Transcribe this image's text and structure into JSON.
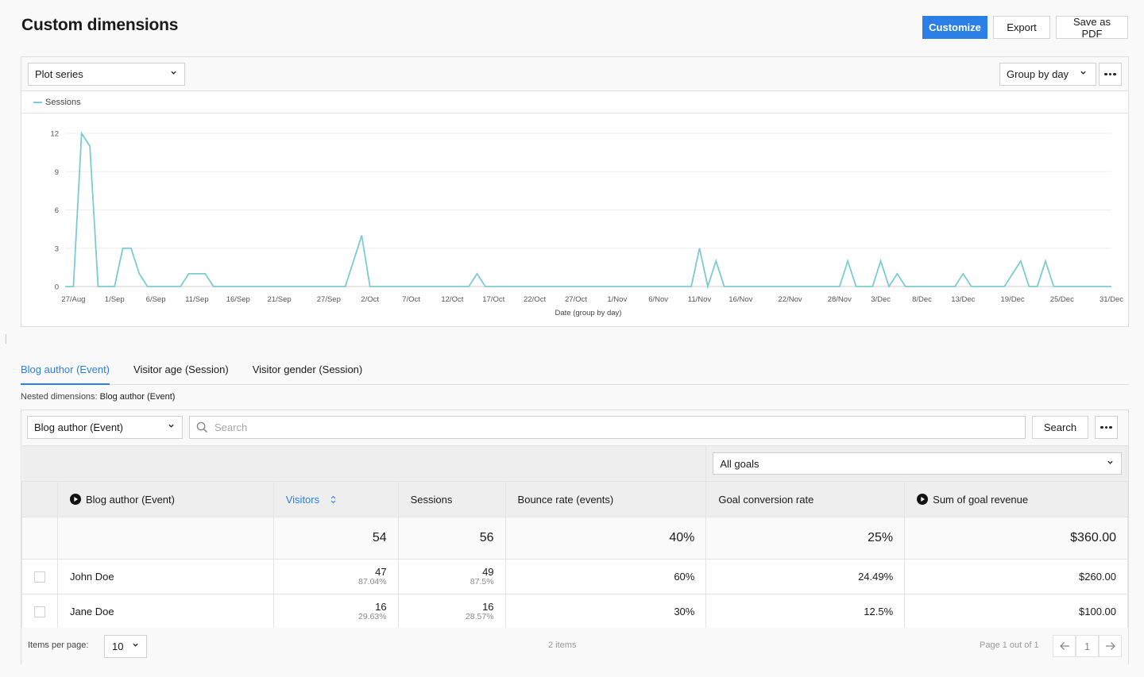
{
  "header": {
    "title": "Custom dimensions",
    "actions": {
      "customize": "Customize",
      "export": "Export",
      "save_pdf": "Save as PDF"
    }
  },
  "colors": {
    "accent": "#2b7fe6",
    "series": "#7ccbd3"
  },
  "chart_toolbar": {
    "plot_series": "Plot series",
    "group_by": "Group by day",
    "more": "more-options"
  },
  "chart_data": {
    "type": "line",
    "title": "",
    "legend": [
      "Sessions"
    ],
    "legend_position": "top-left",
    "xlabel": "Date (group by day)",
    "ylabel": "",
    "ylim": [
      0,
      12
    ],
    "yticks": [
      0,
      3,
      6,
      9,
      12
    ],
    "grid": true,
    "start_date": "26/Aug",
    "end_date": "31/Dec",
    "xtick_labels": [
      {
        "label": "27/Aug",
        "index": 1
      },
      {
        "label": "1/Sep",
        "index": 6
      },
      {
        "label": "6/Sep",
        "index": 11
      },
      {
        "label": "11/Sep",
        "index": 16
      },
      {
        "label": "16/Sep",
        "index": 21
      },
      {
        "label": "21/Sep",
        "index": 26
      },
      {
        "label": "27/Sep",
        "index": 32
      },
      {
        "label": "2/Oct",
        "index": 37
      },
      {
        "label": "7/Oct",
        "index": 42
      },
      {
        "label": "12/Oct",
        "index": 47
      },
      {
        "label": "17/Oct",
        "index": 52
      },
      {
        "label": "22/Oct",
        "index": 57
      },
      {
        "label": "27/Oct",
        "index": 62
      },
      {
        "label": "1/Nov",
        "index": 67
      },
      {
        "label": "6/Nov",
        "index": 72
      },
      {
        "label": "11/Nov",
        "index": 77
      },
      {
        "label": "16/Nov",
        "index": 82
      },
      {
        "label": "22/Nov",
        "index": 88
      },
      {
        "label": "28/Nov",
        "index": 94
      },
      {
        "label": "3/Dec",
        "index": 99
      },
      {
        "label": "8/Dec",
        "index": 104
      },
      {
        "label": "13/Dec",
        "index": 109
      },
      {
        "label": "19/Dec",
        "index": 115
      },
      {
        "label": "25/Dec",
        "index": 121
      },
      {
        "label": "31/Dec",
        "index": 127
      }
    ],
    "series": [
      {
        "name": "Sessions",
        "values": [
          0,
          0,
          12,
          11,
          0,
          0,
          0,
          3,
          3,
          1,
          0,
          0,
          0,
          0,
          0,
          1,
          1,
          1,
          0,
          0,
          0,
          0,
          0,
          0,
          0,
          0,
          0,
          0,
          0,
          0,
          0,
          0,
          0,
          0,
          0,
          2,
          4,
          0,
          0,
          0,
          0,
          0,
          0,
          0,
          0,
          0,
          0,
          0,
          0,
          0,
          1,
          0,
          0,
          0,
          0,
          0,
          0,
          0,
          0,
          0,
          0,
          0,
          0,
          0,
          0,
          0,
          0,
          0,
          0,
          0,
          0,
          0,
          0,
          0,
          0,
          0,
          0,
          3,
          0,
          2,
          0,
          0,
          0,
          0,
          0,
          0,
          0,
          0,
          0,
          0,
          0,
          0,
          0,
          0,
          0,
          2,
          0,
          0,
          0,
          2,
          0,
          1,
          0,
          0,
          0,
          0,
          0,
          0,
          0,
          1,
          0,
          0,
          0,
          0,
          0,
          1,
          2,
          0,
          0,
          2,
          0,
          0,
          0,
          0,
          0,
          0,
          0,
          0
        ]
      }
    ]
  },
  "tabs": [
    {
      "label": "Blog author (Event)",
      "active": true
    },
    {
      "label": "Visitor age (Session)",
      "active": false
    },
    {
      "label": "Visitor gender (Session)",
      "active": false
    }
  ],
  "nested": {
    "prefix": "Nested dimensions:",
    "value": "Blog author (Event)"
  },
  "table_toolbar": {
    "dimension": "Blog author (Event)",
    "search_placeholder": "Search",
    "search_value": "",
    "search_button": "Search"
  },
  "goals_select": "All goals",
  "table": {
    "columns": [
      "Blog author (Event)",
      "Visitors",
      "Sessions",
      "Bounce rate (events)",
      "Goal conversion rate",
      "Sum of goal revenue"
    ],
    "totals": {
      "visitors": "54",
      "sessions": "56",
      "bounce": "40%",
      "conversion": "25%",
      "revenue": "$360.00"
    },
    "rows": [
      {
        "name": "John Doe",
        "visitors": "47",
        "visitors_pct": "87.04%",
        "sessions": "49",
        "sessions_pct": "87.5%",
        "bounce": "60%",
        "conversion": "24.49%",
        "revenue": "$260.00"
      },
      {
        "name": "Jane Doe",
        "visitors": "16",
        "visitors_pct": "29.63%",
        "sessions": "16",
        "sessions_pct": "28.57%",
        "bounce": "30%",
        "conversion": "12.5%",
        "revenue": "$100.00"
      }
    ]
  },
  "pagination": {
    "items_per_page_label": "Items per page:",
    "items_per_page": "10",
    "items_count": "2 items",
    "page_info": "Page 1 out of 1",
    "current_page": "1"
  }
}
